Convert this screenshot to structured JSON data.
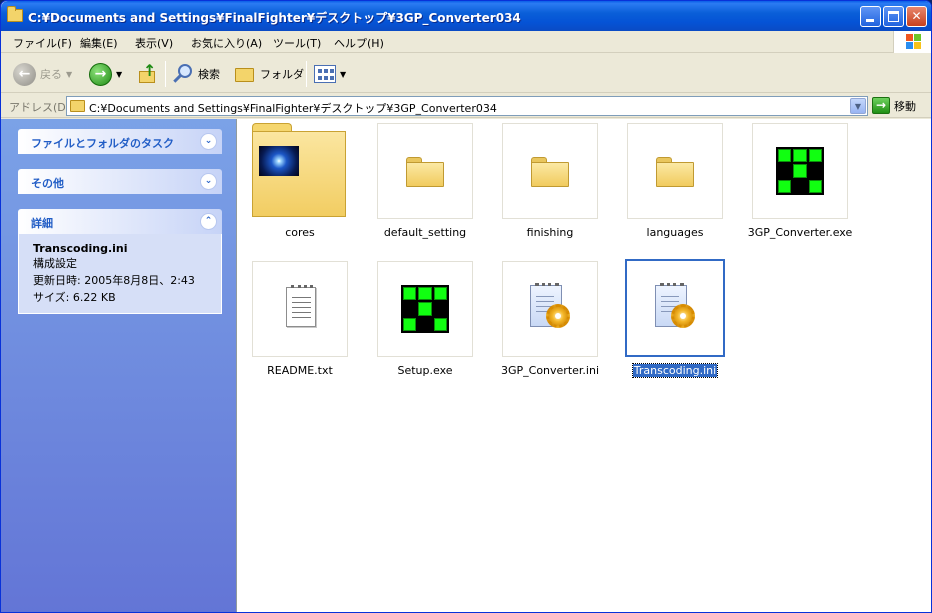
{
  "window": {
    "title": "C:¥Documents and Settings¥FinalFighter¥デスクトップ¥3GP_Converter034"
  },
  "menubar": {
    "items": [
      "ファイル(F)",
      "編集(E)",
      "表示(V)",
      "お気に入り(A)",
      "ツール(T)",
      "ヘルプ(H)"
    ]
  },
  "toolbar": {
    "back_label": "戻る",
    "search_label": "検索",
    "folders_label": "フォルダ"
  },
  "addressbar": {
    "label": "アドレス(D)",
    "path": "C:¥Documents and Settings¥FinalFighter¥デスクトップ¥3GP_Converter034",
    "go_label": "移動"
  },
  "taskpane": {
    "sections": [
      {
        "title": "ファイルとフォルダのタスク",
        "toggle": "⌄"
      },
      {
        "title": "その他",
        "toggle": "⌄"
      },
      {
        "title": "詳細",
        "toggle": "⌃"
      }
    ],
    "details": {
      "name": "Transcoding.ini",
      "type": "構成設定",
      "modified": "更新日時: 2005年8月8日、2:43",
      "size": "サイズ: 6.22 KB"
    }
  },
  "files": [
    {
      "name": "cores",
      "kind": "folder-thumb"
    },
    {
      "name": "default_setting",
      "kind": "folder"
    },
    {
      "name": "finishing",
      "kind": "folder"
    },
    {
      "name": "languages",
      "kind": "folder"
    },
    {
      "name": "3GP_Converter.exe",
      "kind": "exe"
    },
    {
      "name": "README.txt",
      "kind": "txt"
    },
    {
      "name": "Setup.exe",
      "kind": "exe"
    },
    {
      "name": "3GP_Converter.ini",
      "kind": "ini"
    },
    {
      "name": "Transcoding.ini",
      "kind": "ini",
      "selected": true
    }
  ],
  "colors": {
    "titlebar": "#0553d6",
    "selection": "#316ac5",
    "taskpane_top": "#7ba2e7",
    "taskpane_bottom": "#6375d6",
    "exe_green": "#11ff11"
  }
}
